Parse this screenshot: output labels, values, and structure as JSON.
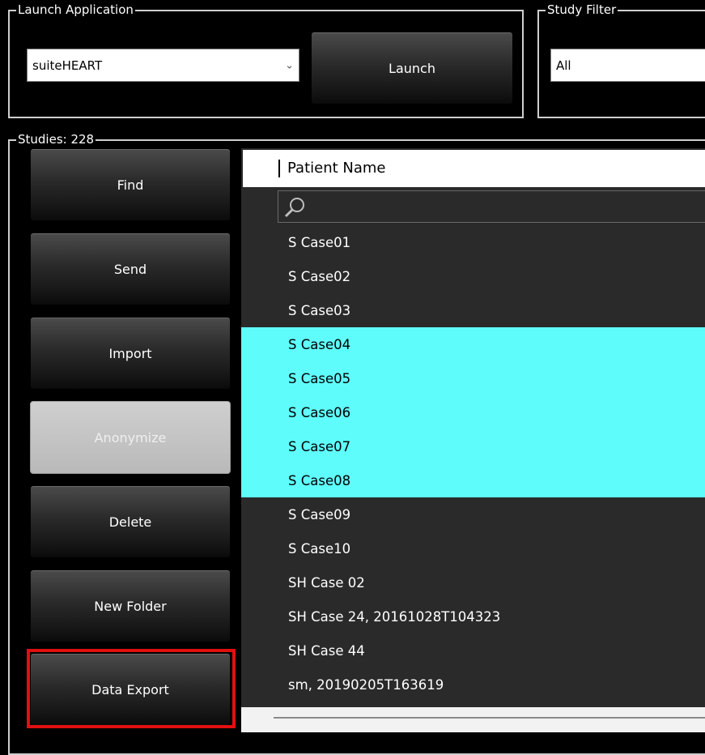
{
  "launch_group": {
    "title": "Launch Application",
    "app_select_value": "suiteHEART",
    "launch_label": "Launch"
  },
  "study_filter_group": {
    "title": "Study Filter",
    "filter_value": "All"
  },
  "studies_group": {
    "title": "Studies: 228",
    "buttons": [
      {
        "label": "Find",
        "enabled": true
      },
      {
        "label": "Send",
        "enabled": true
      },
      {
        "label": "Import",
        "enabled": true
      },
      {
        "label": "Anonymize",
        "enabled": false
      },
      {
        "label": "Delete",
        "enabled": true
      },
      {
        "label": "New Folder",
        "enabled": true
      },
      {
        "label": "Data Export",
        "enabled": true,
        "highlighted": true
      }
    ]
  },
  "study_list": {
    "column_header": "Patient Name",
    "search_placeholder": "",
    "rows": [
      {
        "name": "S Case01",
        "selected": false
      },
      {
        "name": "S Case02",
        "selected": false
      },
      {
        "name": "S Case03",
        "selected": false
      },
      {
        "name": "S Case04",
        "selected": true
      },
      {
        "name": "S Case05",
        "selected": true
      },
      {
        "name": "S Case06",
        "selected": true
      },
      {
        "name": "S Case07",
        "selected": true
      },
      {
        "name": "S Case08",
        "selected": true
      },
      {
        "name": "S Case09",
        "selected": false
      },
      {
        "name": "S Case10",
        "selected": false
      },
      {
        "name": "SH Case 02",
        "selected": false
      },
      {
        "name": "SH Case 24, 20161028T104323",
        "selected": false
      },
      {
        "name": "SH Case 44",
        "selected": false
      },
      {
        "name": "sm, 20190205T163619",
        "selected": false
      }
    ]
  },
  "colors": {
    "selection": "#5ffcfc",
    "highlight_border": "#e01010",
    "panel_bg": "#2a2a2a"
  }
}
